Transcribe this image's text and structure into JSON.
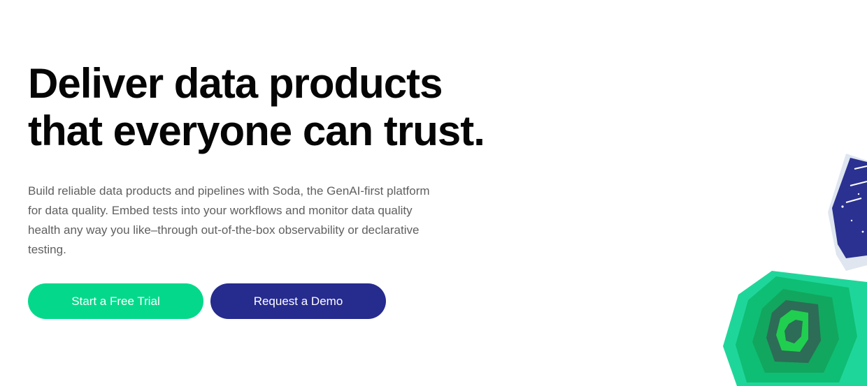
{
  "hero": {
    "title_line1": "Deliver data products",
    "title_line2": "that everyone can trust.",
    "description": "Build reliable data products and pipelines with Soda, the GenAI-first platform for data quality. Embed tests into your workflows and monitor data quality health any way you like–through out-of-the-box observability or declarative testing."
  },
  "cta": {
    "primary_label": "Start a Free Trial",
    "secondary_label": "Request a Demo"
  },
  "colors": {
    "primary_button": "#04d98b",
    "secondary_button": "#262b8e",
    "heading": "#050505",
    "body_text": "#5f5f5f"
  },
  "decorations": {
    "top_right": "navy-hexagon-graphic",
    "bottom_right": "green-contour-hexagon-graphic"
  }
}
